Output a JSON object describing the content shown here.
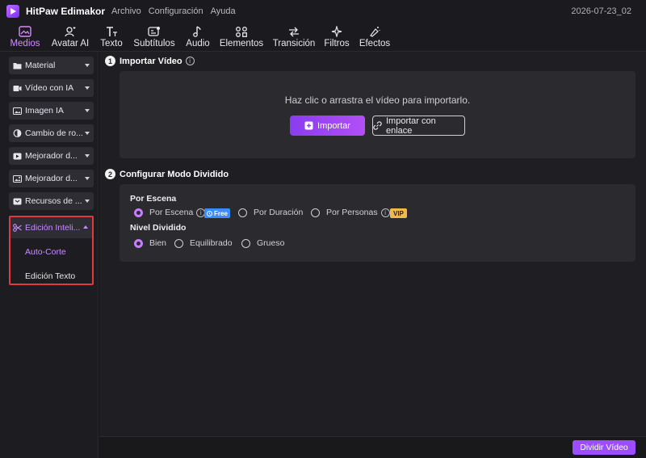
{
  "titlebar": {
    "app_name": "HitPaw Edimakor",
    "menus": [
      "Archivo",
      "Configuración",
      "Ayuda"
    ],
    "datestamp": "2026-07-23_02"
  },
  "toolbar": {
    "tabs": [
      {
        "label": "Medios",
        "icon": "media-icon",
        "active": true
      },
      {
        "label": "Avatar AI",
        "icon": "avatar-icon"
      },
      {
        "label": "Texto",
        "icon": "text-icon"
      },
      {
        "label": "Subtítulos",
        "icon": "subtitles-icon"
      },
      {
        "label": "Audio",
        "icon": "music-note-icon"
      },
      {
        "label": "Elementos",
        "icon": "elements-icon"
      },
      {
        "label": "Transición",
        "icon": "transition-icon"
      },
      {
        "label": "Filtros",
        "icon": "sparkle-icon"
      },
      {
        "label": "Efectos",
        "icon": "effects-icon"
      }
    ],
    "active_color": "#d58cff"
  },
  "sidebar": {
    "items": [
      {
        "label": "Material",
        "icon": "folder-icon"
      },
      {
        "label": "Vídeo con IA",
        "icon": "video-ai-icon"
      },
      {
        "label": "Imagen IA",
        "icon": "image-ai-icon"
      },
      {
        "label": "Cambio de ro...",
        "icon": "face-swap-icon"
      },
      {
        "label": "Mejorador d...",
        "icon": "video-enhance-icon"
      },
      {
        "label": "Mejorador d...",
        "icon": "image-enhance-icon"
      },
      {
        "label": "Recursos de ...",
        "icon": "resources-icon"
      }
    ],
    "expanded": {
      "label": "Edición Inteli...",
      "icon": "scissors-icon",
      "subitems": [
        {
          "label": "Auto-Corte",
          "active": true
        },
        {
          "label": "Edición Texto",
          "active": false
        }
      ]
    }
  },
  "main": {
    "step1": {
      "number": "1",
      "title": "Importar Vídeo",
      "hint": "Haz clic o arrastra el vídeo para importarlo.",
      "import_label": "Importar",
      "link_label": "Importar con enlace"
    },
    "step2": {
      "number": "2",
      "title": "Configurar Modo Dividido",
      "scene_label": "Por Escena",
      "scene_options": [
        {
          "label": "Por Escena",
          "selected": true,
          "badge": "Free"
        },
        {
          "label": "Por Duración",
          "selected": false
        },
        {
          "label": "Por Personas",
          "selected": false,
          "badge": "VIP"
        }
      ],
      "level_label": "Nivel Dividido",
      "level_options": [
        {
          "label": "Bien",
          "selected": true
        },
        {
          "label": "Equilibrado",
          "selected": false
        },
        {
          "label": "Grueso",
          "selected": false
        }
      ]
    },
    "split_button": "Dividir Vídeo",
    "accent": "#9c4dff"
  }
}
